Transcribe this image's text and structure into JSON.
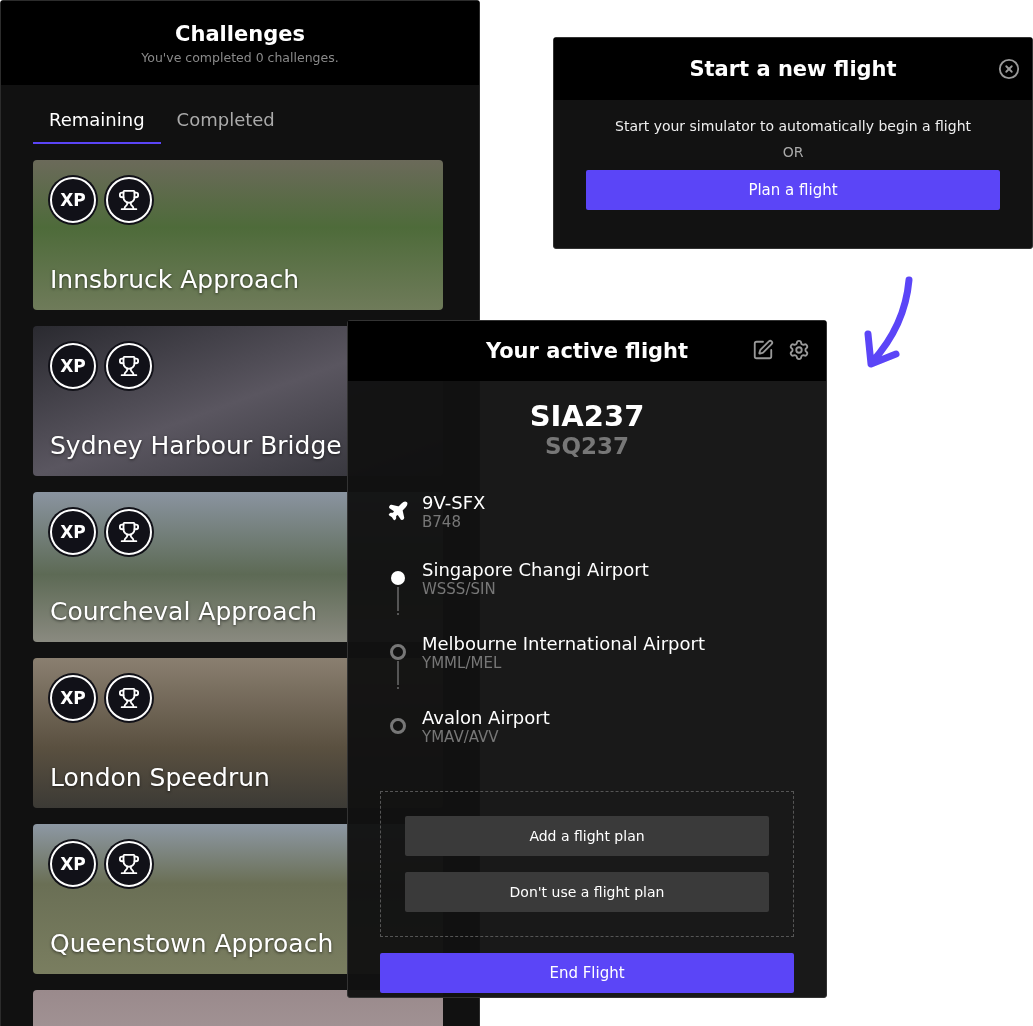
{
  "challenges": {
    "title": "Challenges",
    "subtitle": "You've completed 0 challenges.",
    "tabs": [
      {
        "label": "Remaining",
        "selected": true
      },
      {
        "label": "Completed",
        "selected": false
      }
    ],
    "cards": [
      {
        "kind": "challenge",
        "title": "Innsbruck Approach",
        "badges": [
          {
            "kind": "text",
            "label": "XP"
          },
          {
            "kind": "trophy"
          }
        ]
      },
      {
        "kind": "challenge",
        "title": "Sydney Harbour Bridge",
        "badges": [
          {
            "kind": "text",
            "label": "XP"
          },
          {
            "kind": "trophy"
          }
        ]
      },
      {
        "kind": "challenge",
        "title": "Courcheval Approach",
        "badges": [
          {
            "kind": "text",
            "label": "XP"
          },
          {
            "kind": "trophy"
          }
        ]
      },
      {
        "kind": "challenge",
        "title": "London Speedrun",
        "badges": [
          {
            "kind": "text",
            "label": "XP"
          },
          {
            "kind": "trophy"
          }
        ]
      },
      {
        "kind": "challenge",
        "title": "Queenstown Approach",
        "badges": [
          {
            "kind": "text",
            "label": "XP"
          },
          {
            "kind": "trophy"
          }
        ]
      },
      {
        "kind": "partial"
      }
    ]
  },
  "new_flight": {
    "title": "Start a new flight",
    "message": "Start your simulator to automatically begin a flight",
    "separator": "OR",
    "button": "Plan a flight"
  },
  "active_flight": {
    "title": "Your active flight",
    "callsign": "SIA237",
    "flight_number": "SQ237",
    "route": [
      {
        "kind": "aircraft",
        "name": "9V-SFX",
        "code": "B748"
      },
      {
        "kind": "airport",
        "name": "Singapore Changi Airport",
        "code": "WSSS/SIN",
        "current": true
      },
      {
        "kind": "airport",
        "name": "Melbourne International Airport",
        "code": "YMML/MEL",
        "current": false
      },
      {
        "kind": "airport",
        "name": "Avalon Airport",
        "code": "YMAV/AVV",
        "current": false
      }
    ],
    "plan_buttons": [
      "Add a flight plan",
      "Don't use a flight plan"
    ],
    "end_button": "End Flight"
  }
}
